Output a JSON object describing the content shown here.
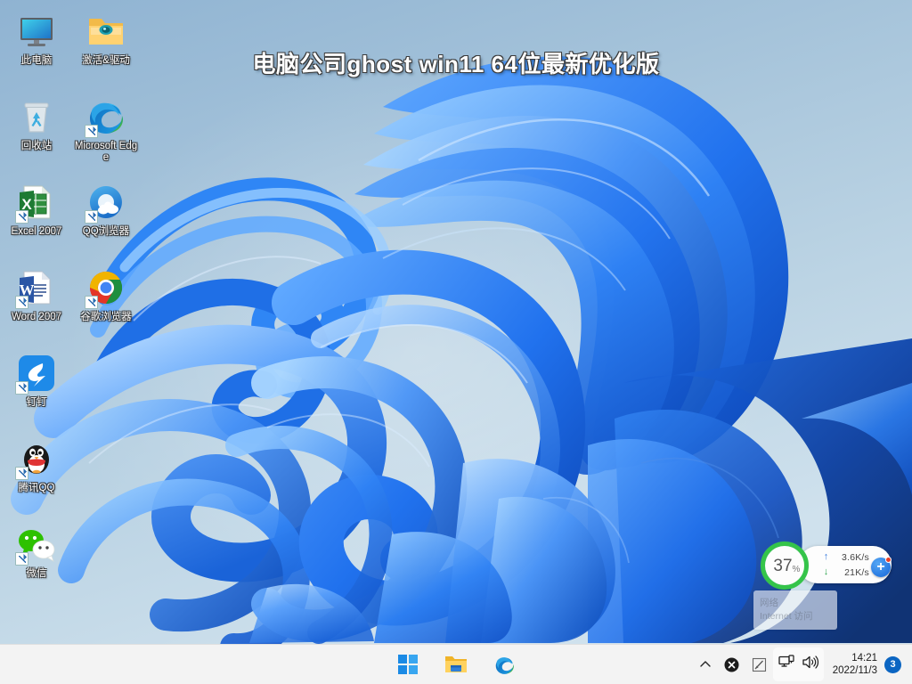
{
  "desktop": {
    "title": "电脑公司ghost win11 64位最新优化版",
    "icons_column_1": [
      {
        "label": "此电脑",
        "icon": "this-pc-monitor-icon",
        "shortcut": false
      },
      {
        "label": "回收站",
        "icon": "recycle-bin-icon",
        "shortcut": false
      },
      {
        "label": "Excel 2007",
        "icon": "excel-icon",
        "shortcut": true
      },
      {
        "label": "Word 2007",
        "icon": "word-icon",
        "shortcut": true
      },
      {
        "label": "钉钉",
        "icon": "dingtalk-icon",
        "shortcut": true
      },
      {
        "label": "腾讯QQ",
        "icon": "qq-penguin-icon",
        "shortcut": true
      },
      {
        "label": "微信",
        "icon": "wechat-icon",
        "shortcut": true
      }
    ],
    "icons_column_2": [
      {
        "label": "激活&驱动",
        "icon": "folder-icon",
        "shortcut": false
      },
      {
        "label": "Microsoft Edge",
        "icon": "edge-icon",
        "shortcut": true
      },
      {
        "label": "QQ浏览器",
        "icon": "qq-browser-icon",
        "shortcut": true
      },
      {
        "label": "谷歌浏览器",
        "icon": "chrome-icon",
        "shortcut": true
      }
    ]
  },
  "float_widget": {
    "memory_percent": "37",
    "percent_sign": "%",
    "ring_color": "#35c44a",
    "upload_arrow": "↑",
    "upload_speed": "3.6K/s",
    "download_arrow": "↓",
    "download_speed": "21K/s",
    "add_button_label": "+",
    "has_notification_dot": true
  },
  "network_tooltip": {
    "line1": "网络",
    "line2": "Internet 访问"
  },
  "taskbar": {
    "center_buttons": [
      {
        "name": "start-button",
        "icon": "windows-logo-icon",
        "label": "开始"
      },
      {
        "name": "file-explorer-button",
        "icon": "folder-explorer-icon",
        "label": "文件资源管理器"
      },
      {
        "name": "edge-button",
        "icon": "edge-icon",
        "label": "Microsoft Edge"
      }
    ],
    "tray": {
      "overflow_icon": "chevron-up-icon",
      "security_icon": "close-circle-icon",
      "pen_icon": "pen-checkbox-icon",
      "network_icon": "network-monitor-icon",
      "volume_icon": "speaker-icon",
      "time": "14:21",
      "date": "2022/11/3",
      "notification_count": "3"
    }
  },
  "colors": {
    "taskbar_bg": "#f3f3f3",
    "wallpaper_sky_top": "#9dbdd8",
    "wallpaper_sky_bottom": "#cde0ec",
    "bloom_blue": "#1a6ff0",
    "accent_blue": "#0b65c2",
    "ring_green": "#35c44a"
  }
}
